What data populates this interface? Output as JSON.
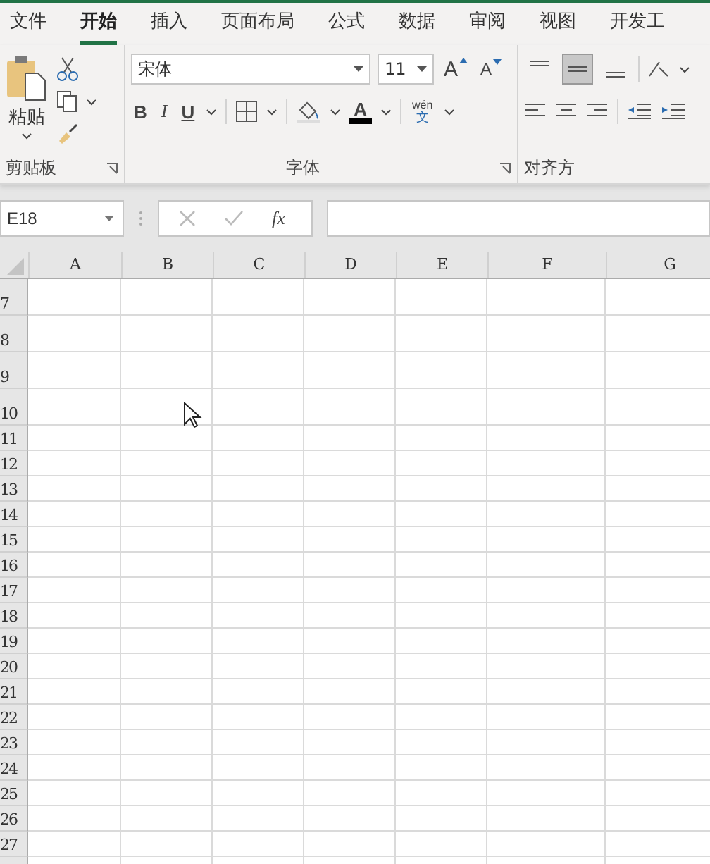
{
  "tabs": [
    {
      "label": "文件",
      "selected": false
    },
    {
      "label": "开始",
      "selected": true
    },
    {
      "label": "插入",
      "selected": false
    },
    {
      "label": "页面布局",
      "selected": false
    },
    {
      "label": "公式",
      "selected": false
    },
    {
      "label": "数据",
      "selected": false
    },
    {
      "label": "审阅",
      "selected": false
    },
    {
      "label": "视图",
      "selected": false
    },
    {
      "label": "开发工",
      "selected": false
    }
  ],
  "clipboard": {
    "paste_label": "粘贴",
    "group_label": "剪贴板"
  },
  "font": {
    "name": "宋体",
    "size": "11",
    "grow": "A",
    "shrink": "A",
    "bold": "B",
    "italic": "I",
    "underline": "U",
    "font_color": "A",
    "phonetic_top": "wén",
    "phonetic_bottom": "文",
    "group_label": "字体"
  },
  "alignment": {
    "vertical": [
      {
        "selected": false
      },
      {
        "selected": true
      },
      {
        "selected": false
      }
    ],
    "group_label": "对齐方"
  },
  "formula_bar": {
    "name_box": "E18",
    "fx": "fx"
  },
  "columns": [
    "A",
    "B",
    "C",
    "D",
    "E",
    "F",
    "G"
  ],
  "rows": [
    "7",
    "8",
    "9",
    "10",
    "11",
    "12",
    "13",
    "14",
    "15",
    "16",
    "17",
    "18",
    "19",
    "20",
    "21",
    "22",
    "23",
    "24",
    "25",
    "26",
    "27"
  ]
}
